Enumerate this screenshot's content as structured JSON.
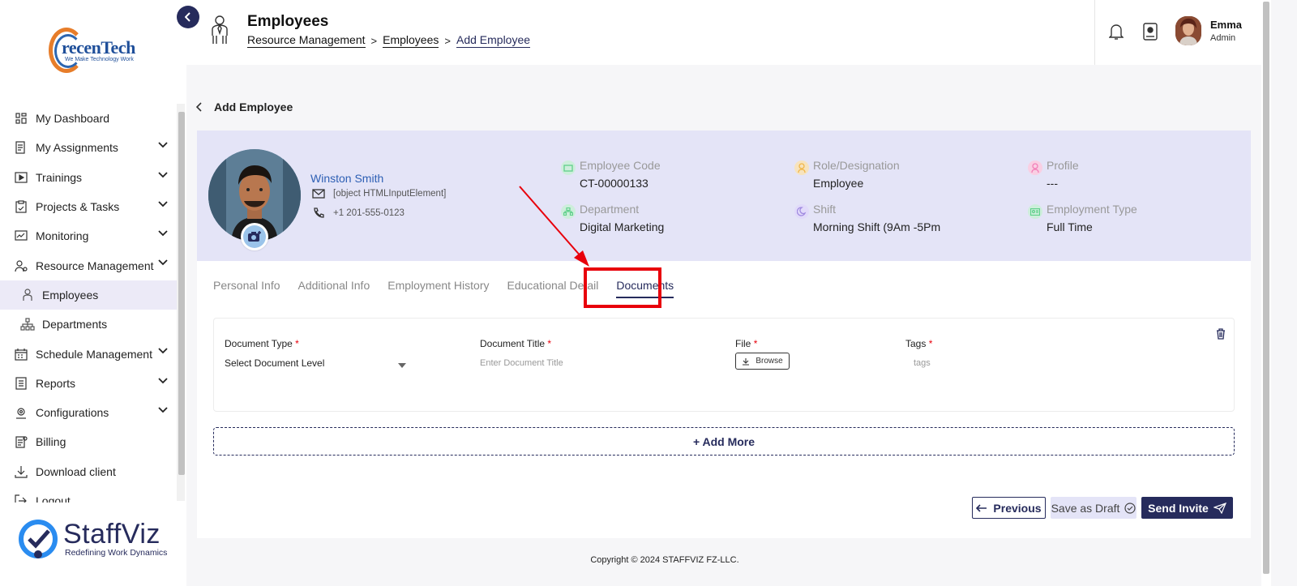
{
  "sidebar": {
    "logo": {
      "text": "recenTech",
      "tagline": "We Make Technology Work"
    },
    "items": [
      {
        "label": "My Dashboard",
        "icon": "dashboard-icon",
        "expandable": false
      },
      {
        "label": "My Assignments",
        "icon": "assignments-icon",
        "expandable": true
      },
      {
        "label": "Trainings",
        "icon": "play-icon",
        "expandable": true
      },
      {
        "label": "Projects & Tasks",
        "icon": "clipboard-icon",
        "expandable": true
      },
      {
        "label": "Monitoring",
        "icon": "monitoring-icon",
        "expandable": true
      },
      {
        "label": "Resource Management",
        "icon": "resource-icon",
        "expandable": true
      },
      {
        "label": "Employees",
        "icon": "employee-icon",
        "sub": true,
        "active": true
      },
      {
        "label": "Departments",
        "icon": "departments-icon",
        "sub": true
      },
      {
        "label": "Schedule Management",
        "icon": "calendar-icon",
        "expandable": true
      },
      {
        "label": "Reports",
        "icon": "reports-icon",
        "expandable": true
      },
      {
        "label": "Configurations",
        "icon": "configurations-icon",
        "expandable": true
      },
      {
        "label": "Billing",
        "icon": "billing-icon",
        "expandable": false
      },
      {
        "label": "Download client",
        "icon": "download-icon",
        "expandable": false
      },
      {
        "label": "Logout",
        "icon": "logout-icon",
        "expandable": false
      }
    ],
    "brand": {
      "name": "StaffViz",
      "tagline": "Redefining Work Dynamics"
    }
  },
  "header": {
    "title": "Employees",
    "breadcrumb": [
      "Resource Management",
      "Employees",
      "Add Employee"
    ],
    "user": {
      "name": "Emma",
      "role": "Admin"
    }
  },
  "back_label": "Add Employee",
  "employee": {
    "name": "Winston Smith",
    "email": "[object HTMLInputElement]",
    "phone": "+1 201-555-0123",
    "fields": [
      {
        "label": "Employee Code",
        "value": "CT-00000133",
        "color": "#5fd08a"
      },
      {
        "label": "Role/Designation",
        "value": "Employee",
        "color": "#f1b64a"
      },
      {
        "label": "Profile",
        "value": "---",
        "color": "#f27fb8"
      },
      {
        "label": "Department",
        "value": "Digital Marketing",
        "color": "#5fd08a"
      },
      {
        "label": "Shift",
        "value": "Morning Shift (9Am -5Pm",
        "color": "#a08ae0"
      },
      {
        "label": "Employment Type",
        "value": "Full Time",
        "color": "#5fd08a"
      }
    ]
  },
  "tabs": [
    "Personal Info",
    "Additional Info",
    "Employment History",
    "Educational Detail",
    "Documents"
  ],
  "active_tab": "Documents",
  "document_form": {
    "type_label": "Document Type",
    "type_value": "Select Document Level",
    "title_label": "Document Title",
    "title_placeholder": "Enter Document Title",
    "file_label": "File",
    "browse_label": "Browse",
    "tags_label": "Tags",
    "tags_placeholder": "tags",
    "required_mark": "*"
  },
  "add_more_label": "+ Add More",
  "buttons": {
    "previous": "Previous",
    "draft": "Save as Draft",
    "send": "Send Invite"
  },
  "footer": "Copyright © 2024 STAFFVIZ FZ-LLC.",
  "colors": {
    "primary": "#262b5c",
    "banner": "#e4e4f7",
    "highlight": "#e8000b",
    "link": "#2d5fb4"
  }
}
